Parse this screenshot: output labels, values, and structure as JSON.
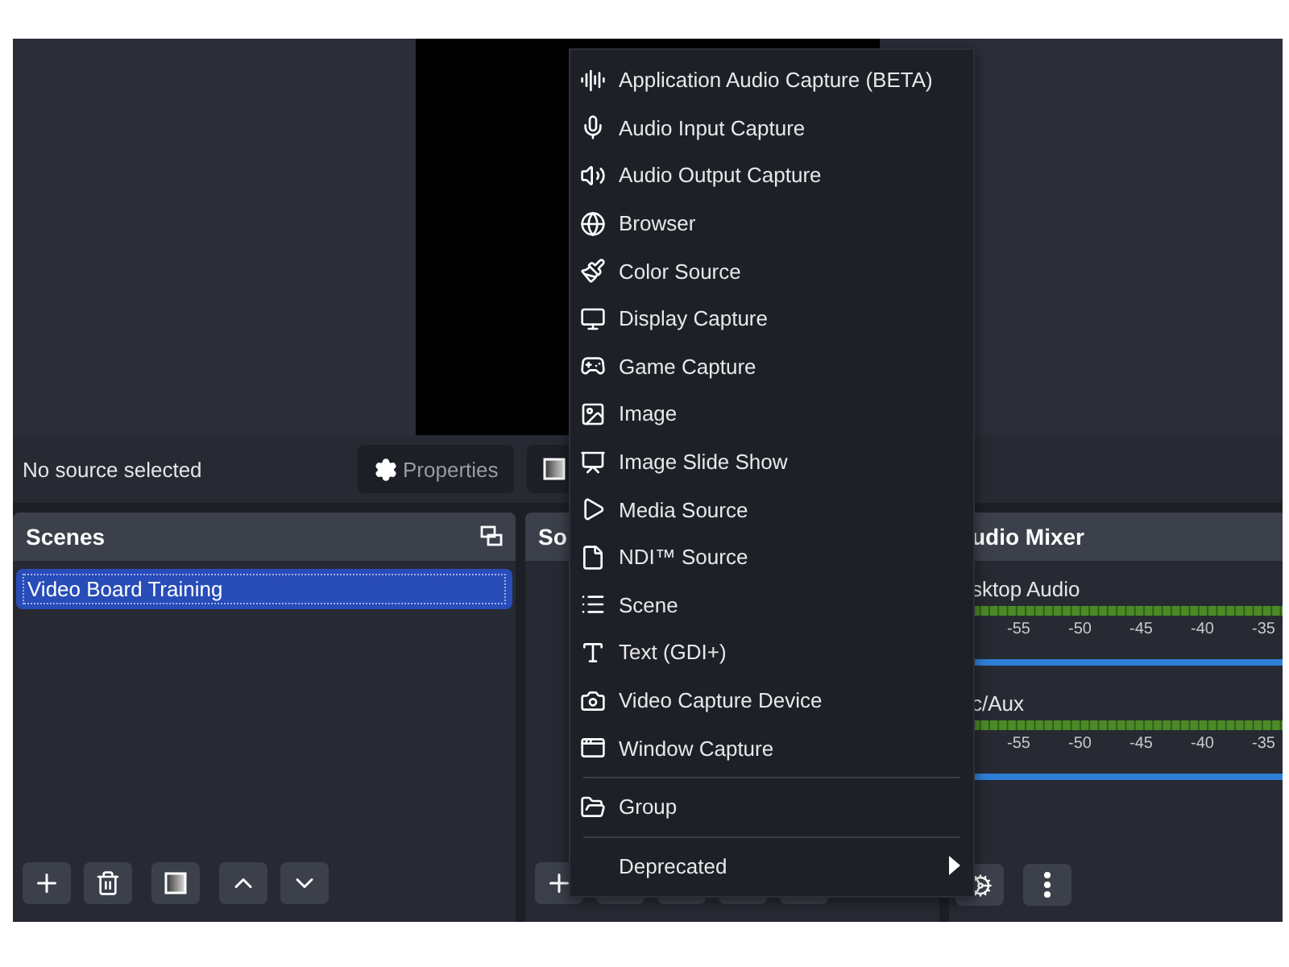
{
  "status": {
    "text": "No source selected"
  },
  "controls": [
    {
      "kind": "properties",
      "label": "Properties"
    },
    {
      "kind": "filters"
    }
  ],
  "scenes": {
    "title": "Scenes",
    "items": [
      {
        "name": "Video Board Training",
        "selected": true
      }
    ]
  },
  "sources": {
    "title": "So"
  },
  "audio_mixer": {
    "title": "udio Mixer",
    "channels": [
      {
        "name": "sktop Audio",
        "ticks": [
          "-55",
          "-50",
          "-45",
          "-40",
          "-35"
        ],
        "level": 1
      },
      {
        "name": "c/Aux",
        "ticks": [
          "-55",
          "-50",
          "-45",
          "-40",
          "-35"
        ],
        "level": 1
      }
    ]
  },
  "menu": {
    "sections": [
      [
        {
          "label": "Application Audio Capture (BETA)"
        },
        {
          "label": "Audio Input Capture"
        },
        {
          "label": "Audio Output Capture"
        },
        {
          "label": "Browser"
        },
        {
          "label": "Color Source"
        },
        {
          "label": "Display Capture"
        },
        {
          "label": "Game Capture"
        },
        {
          "label": "Image"
        },
        {
          "label": "Image Slide Show"
        },
        {
          "label": "Media Source"
        },
        {
          "label": "NDI™ Source"
        },
        {
          "label": "Scene"
        },
        {
          "label": "Text (GDI+)"
        },
        {
          "label": "Video Capture Device"
        },
        {
          "label": "Window Capture"
        }
      ],
      [
        {
          "label": "Group"
        }
      ],
      [
        {
          "label": "Deprecated",
          "submenu": true
        }
      ]
    ]
  }
}
